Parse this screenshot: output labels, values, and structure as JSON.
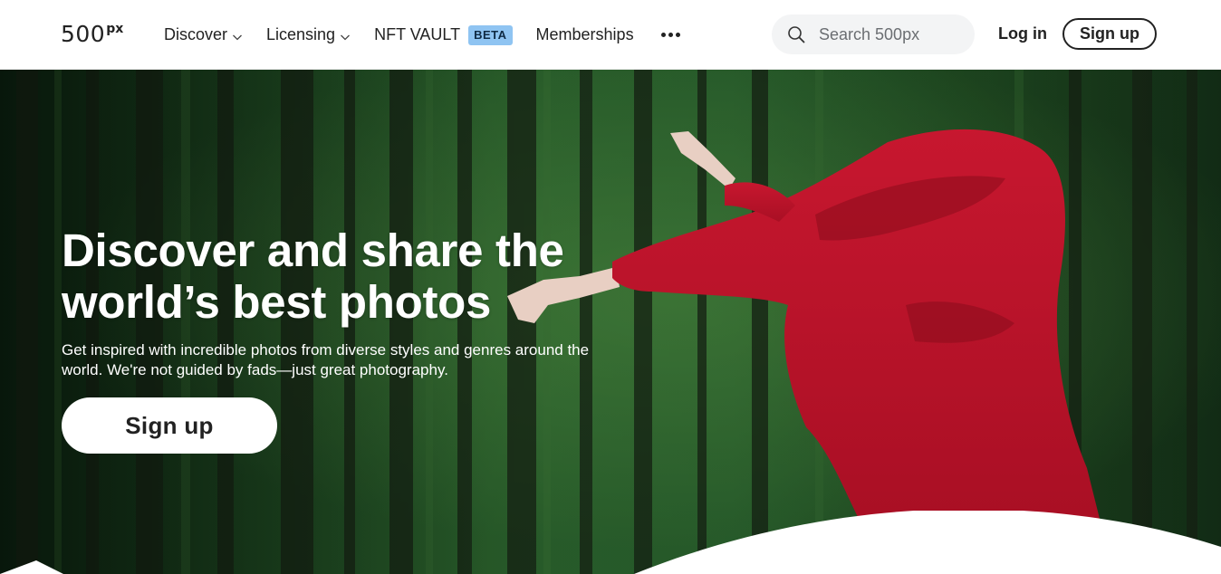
{
  "header": {
    "logo_text": "500",
    "logo_sup": "px",
    "nav": {
      "discover": "Discover",
      "licensing": "Licensing",
      "nft_vault": "NFT VAULT",
      "nft_badge": "BETA",
      "memberships": "Memberships"
    },
    "search": {
      "placeholder": "Search 500px"
    },
    "login": "Log in",
    "signup": "Sign up"
  },
  "hero": {
    "title": "Discover and share the world’s best photos",
    "subtitle": "Get inspired with incredible photos from diverse styles and genres around the world. We're not guided by fads—just great photography.",
    "signup": "Sign up"
  },
  "colors": {
    "badge": "#8fc4f2",
    "forest": "#2e6a30",
    "cloak": "#c1162d"
  },
  "icons": {
    "search": "search-icon",
    "chevron": "chevron-down-icon",
    "more": "more-dots-icon"
  }
}
